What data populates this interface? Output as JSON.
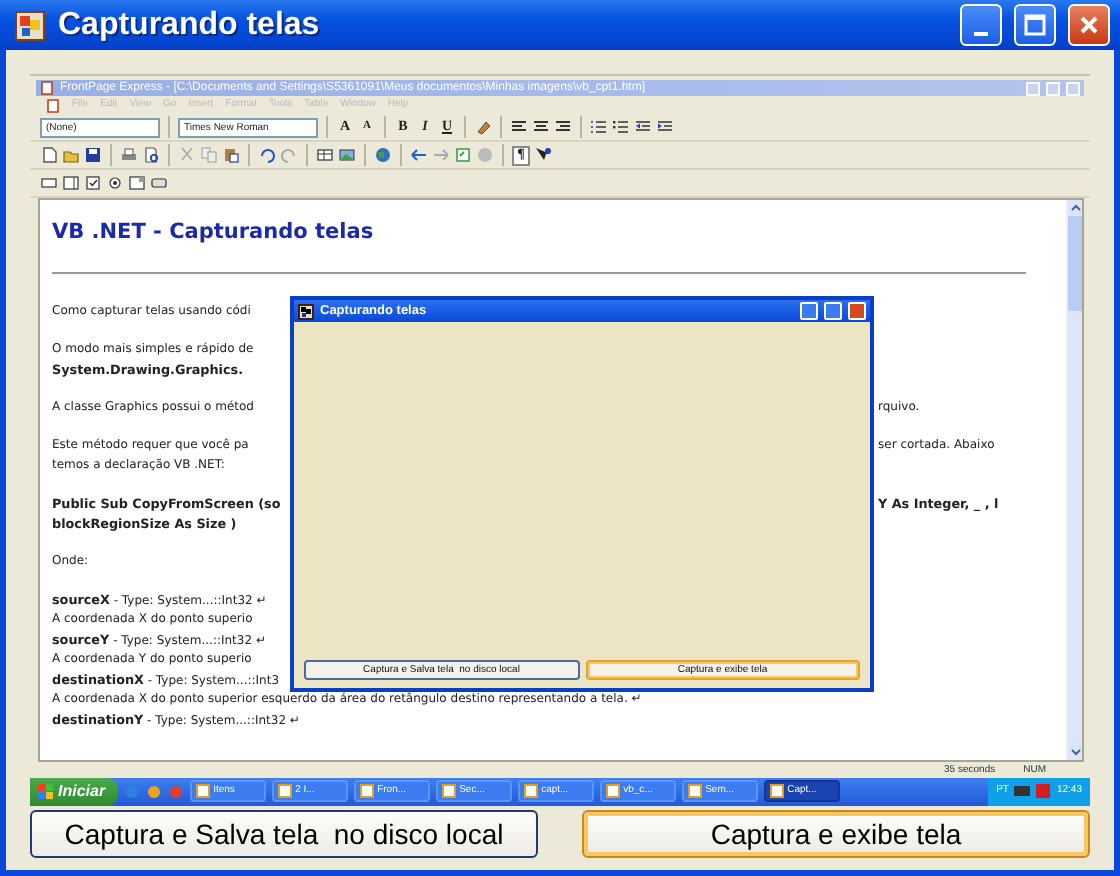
{
  "window": {
    "title": "Capturando telas"
  },
  "screenshot": {
    "app_title": "FrontPage Express - [C:\\Documents and Settings\\S5361091\\Meus documentos\\Minhas imagens\\vb_cpt1.htm]",
    "menu": [
      "File",
      "Edit",
      "View",
      "Go",
      "Insert",
      "Format",
      "Tools",
      "Table",
      "Window",
      "Help"
    ],
    "toolbar": {
      "style_select": "(None)",
      "font_select": "Times New Roman",
      "format_buttons": [
        "A",
        "A",
        "B",
        "I",
        "U"
      ],
      "paragraph_button": "¶"
    },
    "document": {
      "heading": "VB .NET - Capturando telas",
      "paragraphs": [
        {
          "lines": [
            {
              "left": "Como capturar telas usando códi"
            }
          ]
        },
        {
          "lines": [
            {
              "left": "O modo mais simples e rápido de"
            },
            {
              "left": "**System.Drawing.Graphics.**"
            }
          ]
        },
        {
          "lines": [
            {
              "left": "A classe Graphics possui o métod",
              "right": "rquivo."
            }
          ]
        },
        {
          "lines": [
            {
              "left": "Este método requer que você pa",
              "right": "ser cortada. Abaixo"
            },
            {
              "left": "temos a declaração VB .NET:"
            }
          ]
        },
        {
          "lines": [
            {
              "left": "**Public Sub CopyFromScreen (so**",
              "right": "**Y As Integer, _ , l**"
            },
            {
              "left": "**blockRegionSize As Size )**"
            }
          ]
        },
        {
          "lines": [
            {
              "left": "Onde:"
            }
          ]
        },
        {
          "lines": [
            {
              "left": "**sourceX** - Type: System...::Int32 ↵"
            },
            {
              "left": "A coordenada X do ponto superio"
            },
            {
              "left": "**sourceY** - Type: System...::Int32 ↵"
            },
            {
              "left": "A coordenada Y do ponto superio"
            },
            {
              "left": "**destinationX** - Type: System...::Int3"
            },
            {
              "left": "A coordenada X do ponto superior esquerdo da área do retângulo destino representando a tela. ↵"
            },
            {
              "left": "**destinationY** - Type: System...::Int32 ↵"
            }
          ]
        }
      ]
    },
    "status_bar": [
      "35 seconds",
      "NUM"
    ],
    "taskbar": {
      "start": "Iniciar",
      "tasks": [
        {
          "label": "Itens",
          "selected": false
        },
        {
          "label": "2 I...",
          "selected": false
        },
        {
          "label": "Fron...",
          "selected": false
        },
        {
          "label": "Sec...",
          "selected": false
        },
        {
          "label": "capt...",
          "selected": false
        },
        {
          "label": "vb_c...",
          "selected": false
        },
        {
          "label": "Sem...",
          "selected": false
        },
        {
          "label": "Capt...",
          "selected": true
        }
      ],
      "tray_language": "PT",
      "clock": "12:43"
    },
    "dialog": {
      "title": "Capturando telas",
      "buttons": [
        {
          "label": "Captura e Salva tela  no disco local",
          "focused": false
        },
        {
          "label": "Captura e exibe tela",
          "focused": true
        }
      ]
    }
  },
  "buttons": [
    {
      "label": "Captura e Salva tela  no disco local",
      "focused": false
    },
    {
      "label": "Captura e exibe tela",
      "focused": true
    }
  ]
}
